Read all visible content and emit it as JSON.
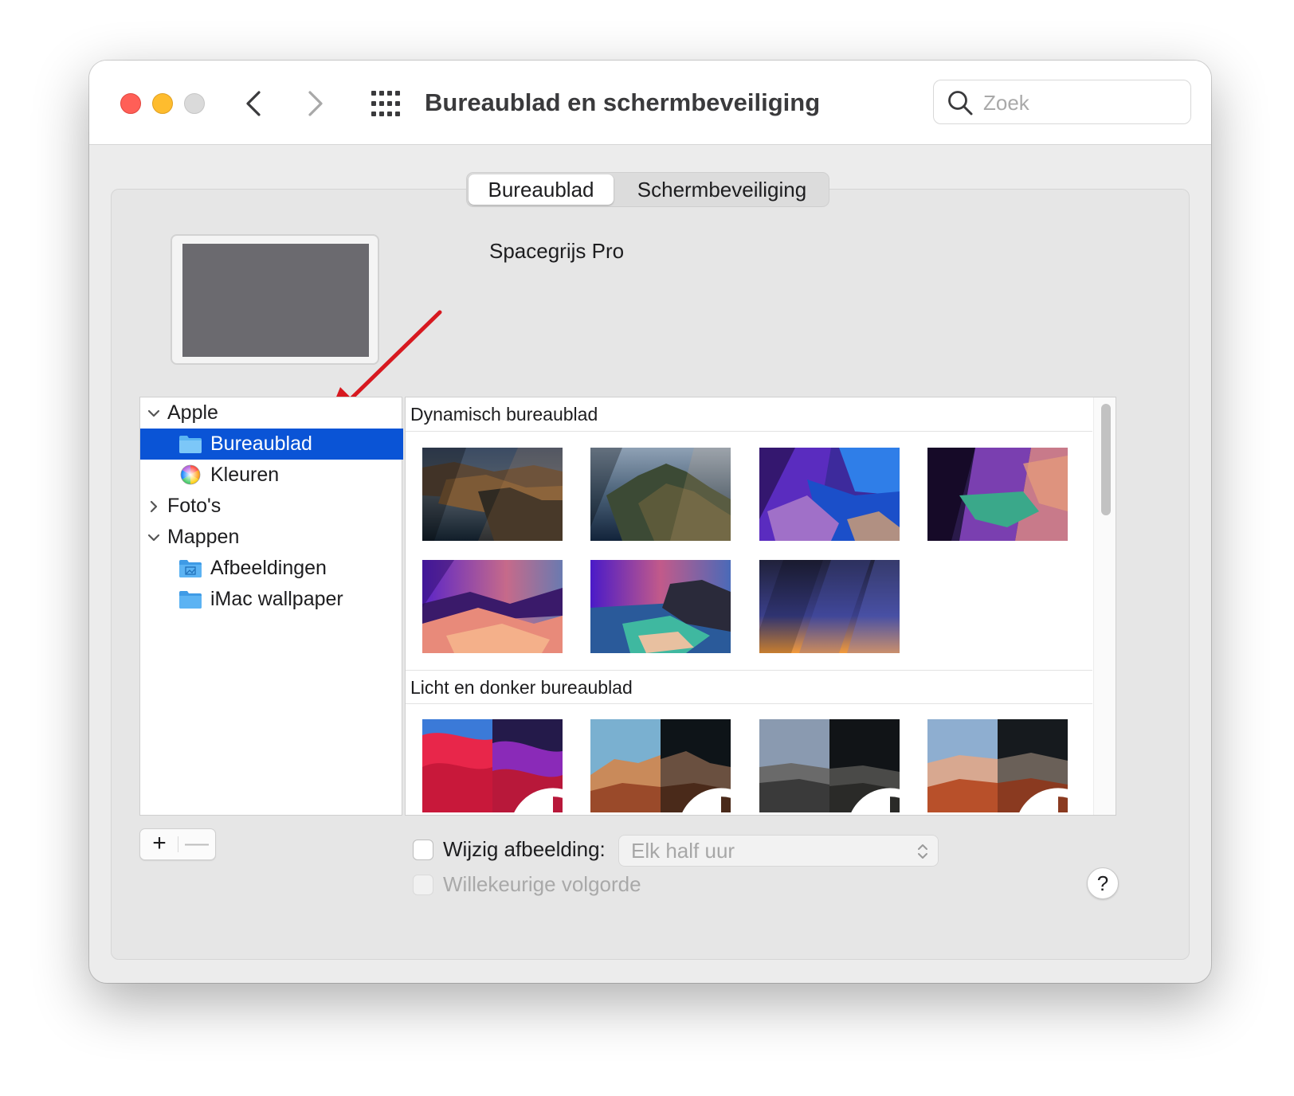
{
  "window": {
    "title": "Bureaublad en schermbeveiliging",
    "search": {
      "placeholder": "Zoek",
      "value": ""
    }
  },
  "tabs": [
    {
      "label": "Bureaublad",
      "selected": true
    },
    {
      "label": "Schermbeveiliging",
      "selected": false
    }
  ],
  "preview": {
    "name": "Spacegrijs Pro",
    "color": "#6b6a6f"
  },
  "annotation": {
    "arrow_color": "#d71920"
  },
  "sources": [
    {
      "label": "Apple",
      "kind": "group",
      "expanded": true
    },
    {
      "label": "Bureaublad",
      "kind": "folder-icon",
      "selected": true
    },
    {
      "label": "Kleuren",
      "kind": "color-wheel-icon",
      "selected": false
    },
    {
      "label": "Foto's",
      "kind": "group",
      "expanded": false
    },
    {
      "label": "Mappen",
      "kind": "group",
      "expanded": true
    },
    {
      "label": "Afbeeldingen",
      "kind": "pictures-folder-icon",
      "selected": false
    },
    {
      "label": "iMac wallpaper",
      "kind": "folder-icon",
      "selected": false
    }
  ],
  "gallery": {
    "sections": [
      {
        "title": "Dynamisch bureaublad",
        "wallpapers": [
          "catalina-coast-dynamic",
          "catalina-island-dynamic",
          "purple-road-dynamic",
          "purple-cliffs-dynamic",
          "desert-dunes-dynamic",
          "island-beach-dynamic",
          "gradient-stripes-dynamic"
        ]
      },
      {
        "title": "Licht en donker bureaublad",
        "wallpapers": [
          "big-sur-waves-light-dark",
          "rock-formation-light-dark",
          "canyon-layers-light-dark",
          "red-rocks-light-dark"
        ]
      }
    ]
  },
  "controls": {
    "change_picture": {
      "label": "Wijzig afbeelding:",
      "checked": false
    },
    "interval": {
      "value": "Elk half uur",
      "enabled": false
    },
    "random_order": {
      "label": "Willekeurige volgorde",
      "checked": false,
      "enabled": false
    },
    "add": "+",
    "remove": "—",
    "help": "?"
  },
  "colors": {
    "selection": "#0a54d6",
    "close": "#ff5f57",
    "minimize": "#febc2e",
    "maximize": "#dadada"
  }
}
